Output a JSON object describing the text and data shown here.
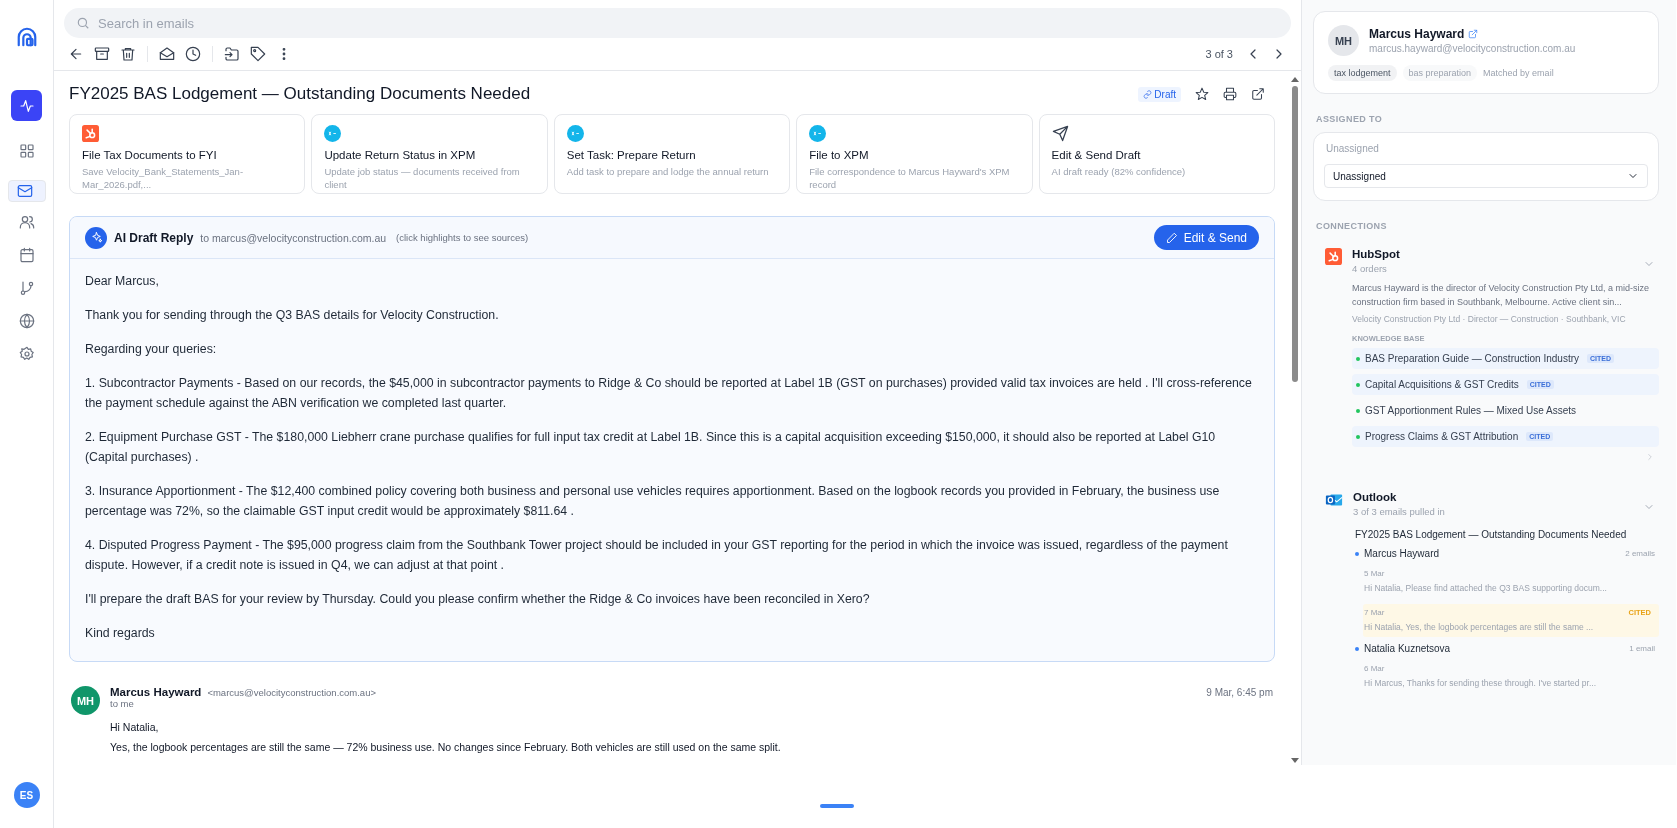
{
  "sidebar": {
    "items": [
      {
        "kind": "activity",
        "selected": false
      },
      {
        "kind": "dashboard",
        "selected": false
      },
      {
        "kind": "mail",
        "selected": true
      },
      {
        "kind": "contacts",
        "selected": false
      },
      {
        "kind": "calendar",
        "selected": false
      },
      {
        "kind": "workflow",
        "selected": false
      },
      {
        "kind": "globe",
        "selected": false
      },
      {
        "kind": "settings",
        "selected": false
      }
    ],
    "user_initials": "ES"
  },
  "search": {
    "placeholder": "Search in emails"
  },
  "toolbar": {
    "pager": "3 of 3"
  },
  "email": {
    "title": "FY2025 BAS Lodgement — Outstanding Documents Needed",
    "badge": "Draft"
  },
  "action_cards": [
    {
      "kind": "hubspot",
      "title": "File Tax Documents to FYI",
      "description": "Save Velocity_Bank_Statements_Jan-Mar_2026.pdf,..."
    },
    {
      "kind": "xero",
      "title": "Update Return Status in XPM",
      "description": "Update job status — documents received from client"
    },
    {
      "kind": "xero",
      "title": "Set Task: Prepare Return",
      "description": "Add task to prepare and lodge the annual return"
    },
    {
      "kind": "xero",
      "title": "File to XPM",
      "description": "File correspondence to Marcus Hayward's XPM record"
    },
    {
      "kind": "send",
      "title": "Edit & Send Draft",
      "description": "AI draft ready (82% confidence)"
    }
  ],
  "ai_draft": {
    "title": "AI Draft Reply",
    "to": "to marcus@velocityconstruction.com.au",
    "hint": "(click highlights to see sources)",
    "button": "Edit & Send",
    "paragraphs": [
      "Dear Marcus,",
      "Thank you for sending through the Q3 BAS details for Velocity Construction.",
      "Regarding your queries:",
      "1. Subcontractor Payments - Based on our records, the $45,000 in subcontractor payments to Ridge & Co should be reported at Label 1B (GST on purchases) provided valid tax invoices are held . I'll cross-reference the payment schedule against the ABN verification we completed last quarter.",
      "2. Equipment Purchase GST - The $180,000 Liebherr crane purchase qualifies for full input tax credit at Label 1B. Since this is a capital acquisition exceeding $150,000, it should also be reported at Label G10 (Capital purchases) .",
      "3. Insurance Apportionment - The $12,400 combined policy covering both business and personal use vehicles requires apportionment. Based on the logbook records you provided in February, the business use percentage was 72%, so the claimable GST input credit would be approximately $811.64 .",
      "4. Disputed Progress Payment - The $95,000 progress claim from the Southbank Tower project should be included in your GST reporting for the period in which the invoice was issued, regardless of the payment dispute. However, if a credit note is issued in Q4, we can adjust at that point .",
      "I'll prepare the draft BAS for your review by Thursday. Could you please confirm whether the Ridge & Co invoices have been reconciled in Xero?",
      "Kind regards"
    ]
  },
  "message": {
    "initials": "MH",
    "sender": "Marcus Hayward",
    "address": "<marcus@velocityconstruction.com.au>",
    "to": "to me",
    "time": "9 Mar, 6:45 pm",
    "body": [
      "Hi Natalia,",
      "Yes, the logbook percentages are still the same — 72% business use. No changes since February. Both vehicles are still used on the same split."
    ]
  },
  "contact": {
    "initials": "MH",
    "name": "Marcus Hayward",
    "email": "marcus.hayward@velocityconstruction.com.au",
    "tags": [
      "tax lodgement",
      "bas preparation"
    ],
    "match_note": "Matched by email"
  },
  "assigned": {
    "heading": "ASSIGNED TO",
    "label": "Unassigned",
    "value": "Unassigned"
  },
  "connections": {
    "heading": "CONNECTIONS",
    "hubspot": {
      "name": "HubSpot",
      "subtitle": "4 orders",
      "description": "Marcus Hayward is the director of Velocity Construction Pty Ltd, a mid-size construction firm based in Southbank, Melbourne. Active client sin...",
      "meta": "Velocity Construction Pty Ltd · Director — Construction · Southbank, VIC",
      "kb_heading": "KNOWLEDGE BASE",
      "kb_items": [
        {
          "title": "BAS Preparation Guide — Construction Industry",
          "cited": true,
          "badge": "CITED"
        },
        {
          "title": "Capital Acquisitions & GST Credits",
          "cited": true,
          "badge": "CITED"
        },
        {
          "title": "GST Apportionment Rules — Mixed Use Assets",
          "cited": false
        },
        {
          "title": "Progress Claims & GST Attribution",
          "cited": true,
          "badge": "CITED"
        }
      ]
    },
    "outlook": {
      "name": "Outlook",
      "subtitle": "3 of 3 emails pulled in",
      "thread_title": "FY2025 BAS Lodgement — Outstanding Documents Needed",
      "senders": [
        {
          "name": "Marcus Hayward",
          "count": "2 emails",
          "emails": [
            {
              "date": "5 Mar",
              "preview": "Hi Natalia, Please find attached the Q3 BAS supporting docum...",
              "cited": false
            },
            {
              "date": "7 Mar",
              "preview": "Hi Natalia, Yes, the logbook percentages are still the same ...",
              "cited": true,
              "badge": "CITED"
            }
          ]
        },
        {
          "name": "Natalia Kuznetsova",
          "count": "1 email",
          "emails": [
            {
              "date": "6 Mar",
              "preview": "Hi Marcus, Thanks for sending these through. I've started pr...",
              "cited": false
            }
          ]
        }
      ]
    }
  }
}
